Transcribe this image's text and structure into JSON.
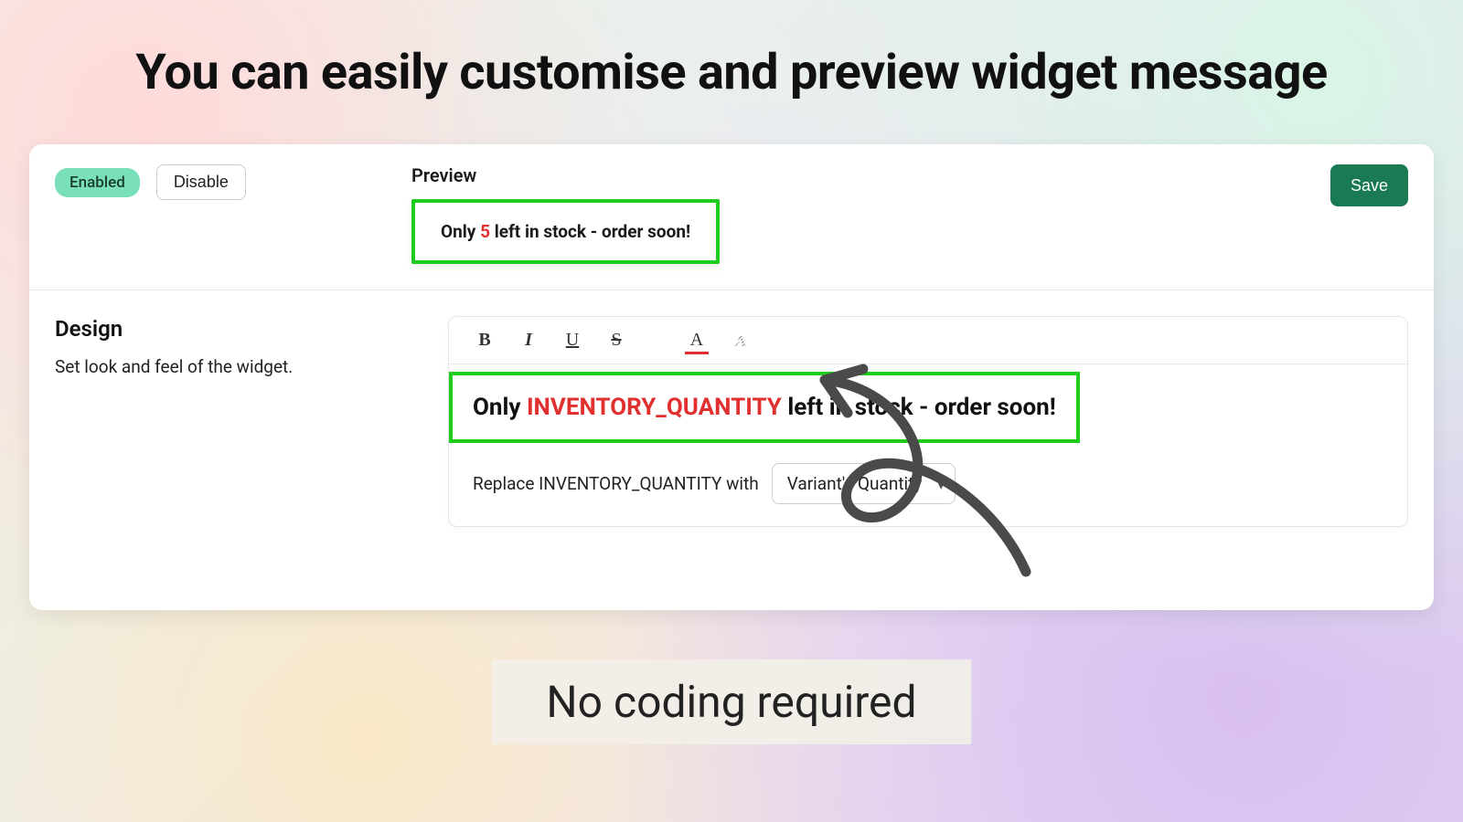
{
  "headline": "You can easily customise and preview widget message",
  "status": {
    "enabled_badge": "Enabled",
    "disable_button": "Disable"
  },
  "save_button": "Save",
  "preview": {
    "label": "Preview",
    "text_before": "Only ",
    "quantity": "5",
    "text_after": " left in stock - order soon!"
  },
  "design": {
    "title": "Design",
    "description": "Set look and feel of the widget."
  },
  "editor": {
    "text_before": "Only ",
    "token": "INVENTORY_QUANTITY",
    "text_after": " left in stock - order soon!"
  },
  "replace": {
    "label": "Replace INVENTORY_QUANTITY with",
    "selected": "Variant's Quantity"
  },
  "toolbar_icons": {
    "bold": "B",
    "italic": "I",
    "underline": "U",
    "strike": "S",
    "fontcolor": "A"
  },
  "footer": "No coding required",
  "colors": {
    "highlight_green": "#1ecc1e",
    "accent_red": "#e03030",
    "save_green": "#1a7a54",
    "badge_green": "#7ae0b9"
  }
}
